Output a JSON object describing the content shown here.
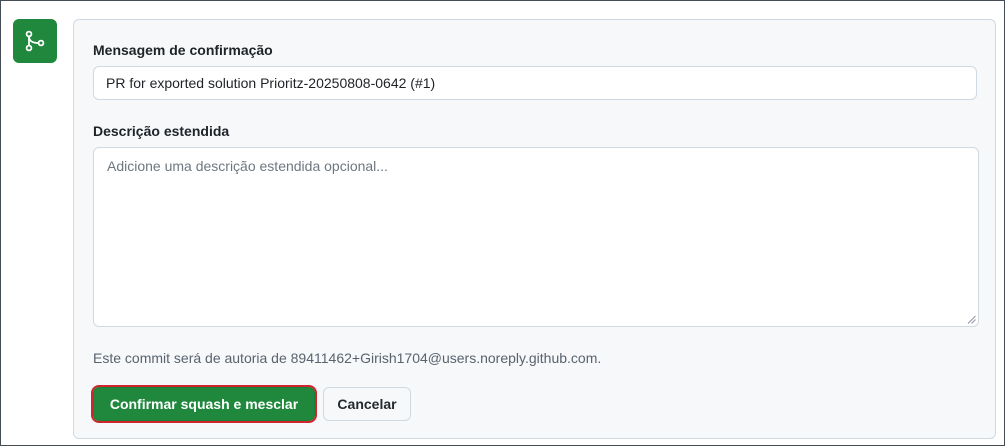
{
  "form": {
    "message_label": "Mensagem de confirmação",
    "message_value": "PR for exported solution Prioritz-20250808-0642 (#1)",
    "description_label": "Descrição estendida",
    "description_placeholder": "Adicione uma descrição estendida opcional...",
    "author_note": "Este commit será de autoria de 89411462+Girish1704@users.noreply.github.com."
  },
  "buttons": {
    "confirm_label": "Confirmar squash e mesclar",
    "cancel_label": "Cancelar"
  },
  "icons": {
    "badge": "git-merge-icon",
    "resize": "resize-grip-icon"
  },
  "colors": {
    "primary_green": "#1f883d",
    "focus_outline": "#d1242f",
    "panel_bg": "#f6f8fa",
    "border": "#d1d9e0"
  }
}
